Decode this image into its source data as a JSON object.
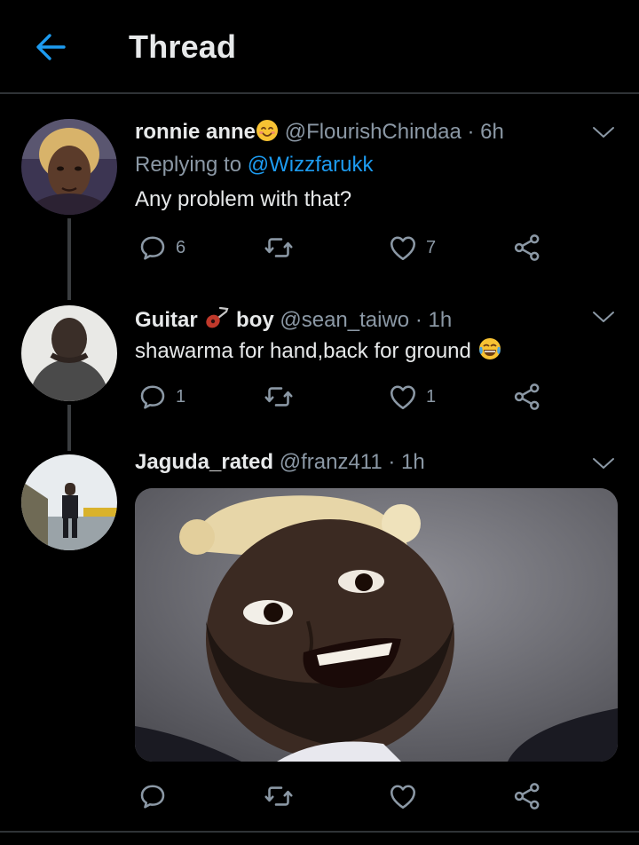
{
  "header": {
    "title": "Thread"
  },
  "tweets": [
    {
      "name": "ronnie anne",
      "handle": "@FlourishChindaa",
      "time": "· 6h",
      "replying_prefix": "Replying to",
      "replying_to": "@Wizzfarukk",
      "text": "Any problem with that?",
      "replies": "6",
      "retweets": "",
      "likes": "7"
    },
    {
      "name_part1": "Guitar",
      "name_part2": "boy",
      "handle": "@sean_taiwo",
      "time": "· 1h",
      "text": "shawarma for hand,back for ground",
      "replies": "1",
      "retweets": "",
      "likes": "1"
    },
    {
      "name": "Jaguda_rated",
      "handle": "@franz411",
      "time": "· 1h",
      "replies": "",
      "retweets": "",
      "likes": ""
    }
  ],
  "icons": {
    "back": "arrow-left-icon",
    "more": "chevron-down-icon",
    "reply": "comment-icon",
    "retweet": "retweet-icon",
    "like": "heart-icon",
    "share": "share-icon"
  },
  "colors": {
    "background": "#000000",
    "accent": "#1d9bf0",
    "muted": "#8b98a5",
    "text": "#e7e9ea"
  }
}
